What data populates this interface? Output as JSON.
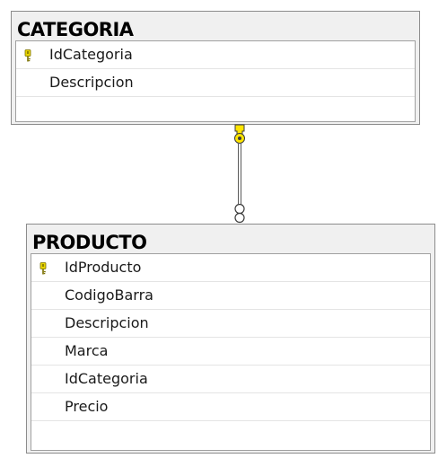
{
  "tables": [
    {
      "name": "CATEGORIA",
      "columns": [
        {
          "name": "IdCategoria",
          "key": true
        },
        {
          "name": "Descripcion",
          "key": false
        }
      ]
    },
    {
      "name": "PRODUCTO",
      "columns": [
        {
          "name": "IdProducto",
          "key": true
        },
        {
          "name": "CodigoBarra",
          "key": false
        },
        {
          "name": "Descripcion",
          "key": false
        },
        {
          "name": "Marca",
          "key": false
        },
        {
          "name": "IdCategoria",
          "key": false
        },
        {
          "name": "Precio",
          "key": false
        }
      ]
    }
  ],
  "relationship": {
    "from": "CATEGORIA",
    "to": "PRODUCTO",
    "one_end_icon": "key-icon",
    "many_end_icon": "infinity-icon",
    "key_color": "#ffe500"
  },
  "colors": {
    "table_background": "#f0f0f0",
    "table_border": "#8c8c8c",
    "grid_background": "#ffffff",
    "key_color": "#d9c800"
  }
}
